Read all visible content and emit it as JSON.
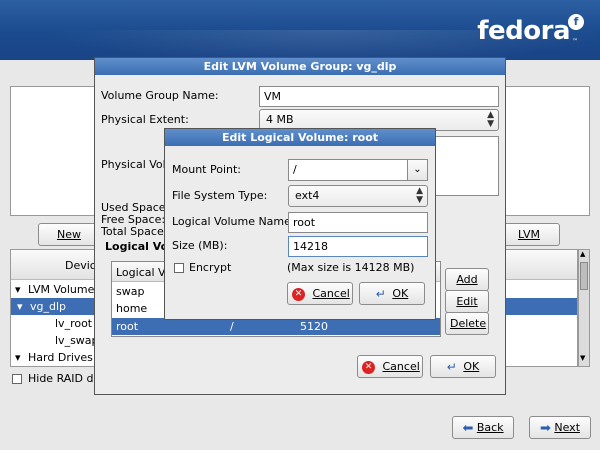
{
  "brand": {
    "logo_text": "fedora",
    "mark_glyph": "f",
    "tm": "™"
  },
  "main": {
    "new_button": "New",
    "lvm_button": "LVM",
    "tree_header": "Devic",
    "tree_items": [
      "LVM Volume G",
      "vg_dlp",
      "lv_root",
      "lv_swap",
      "Hard Drives"
    ],
    "hide_raid_label": "Hide RAID de",
    "back_button": "Back",
    "next_button": "Next"
  },
  "vg_dialog": {
    "title": "Edit LVM Volume Group: vg_dlp",
    "vg_name_label": "Volume Group Name:",
    "vg_name_value": "VM",
    "pe_label": "Physical Extent:",
    "pe_value": "4 MB",
    "pv_label": "Physical Volu",
    "used_space_label": "Used Space:",
    "free_space_label": "Free Space:",
    "total_space_label": "Total Space:",
    "lv_section_label": "Logical Vo",
    "lv_table_header": "Logical Vo",
    "lv_rows": [
      {
        "name": "swap",
        "mount": "",
        "size": ""
      },
      {
        "name": "home",
        "mount": "",
        "size": ""
      },
      {
        "name": "root",
        "mount": "/",
        "size": "5120"
      }
    ],
    "add_button": "Add",
    "edit_button": "Edit",
    "delete_button": "Delete",
    "cancel_button": "Cancel",
    "ok_button": "OK"
  },
  "lv_dialog": {
    "title": "Edit Logical Volume: root",
    "mount_point_label": "Mount Point:",
    "mount_point_value": "/",
    "fs_type_label": "File System Type:",
    "fs_type_value": "ext4",
    "lv_name_label": "Logical Volume Name:",
    "lv_name_value": "root",
    "size_label": "Size (MB):",
    "size_value": "14218",
    "encrypt_label": "Encrypt",
    "max_size_text": "(Max size is 14128 MB)",
    "cancel_button": "Cancel",
    "ok_button": "OK"
  },
  "colors": {
    "banner": "#1b4b8e",
    "title_bar": "#3b6eb2",
    "selection": "#3d6db2"
  }
}
